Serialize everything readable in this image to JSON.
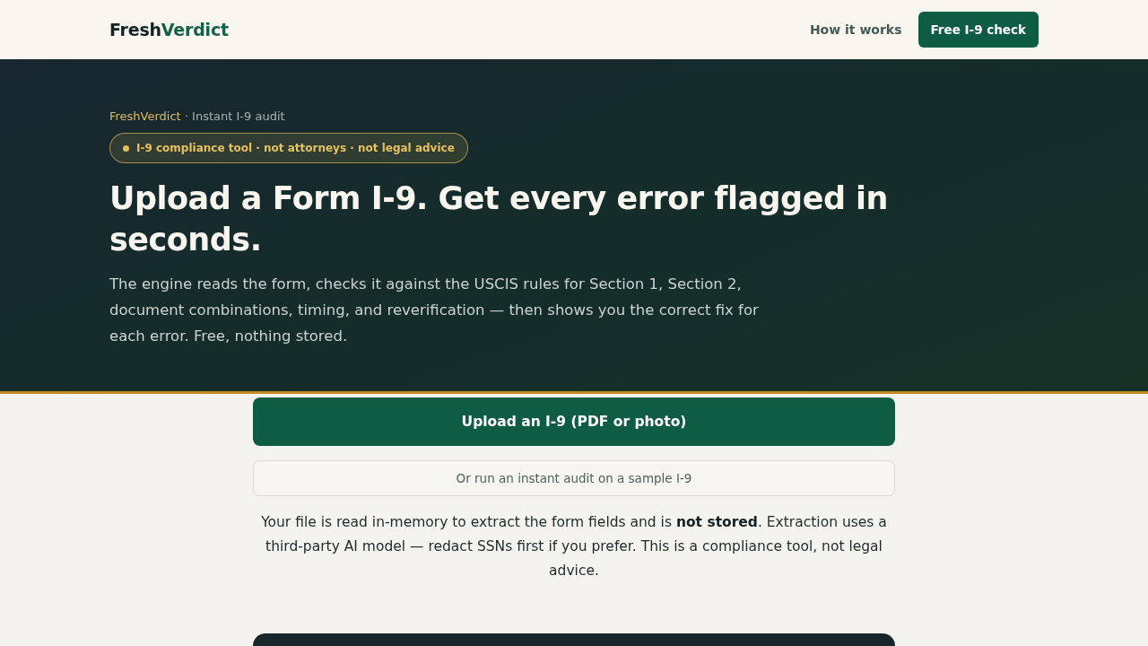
{
  "header": {
    "logo": {
      "first": "Fresh",
      "second": "Verdict"
    },
    "nav_link": "How it works",
    "cta_button": "Free I-9 check"
  },
  "hero": {
    "eyebrow": {
      "brand": "FreshVerdict",
      "text": "· Instant I-9 audit"
    },
    "badge": "I-9 compliance tool · not attorneys · not legal advice",
    "title": "Upload a Form I-9. Get every error flagged in seconds.",
    "description": "The engine reads the form, checks it against the USCIS rules for Section 1, Section 2, document combinations, timing, and reverification — then shows you the correct fix for each error. Free, nothing stored."
  },
  "upload": {
    "primary_button": "Upload an I-9 (PDF or photo)",
    "sample_button": "Or run an instant audit on a sample I-9",
    "notice": "Your file is read in-memory to extract the form fields and is **not stored**. Extraction uses a third-party AI model — redact SSNs first if you prefer. This is a compliance tool, not legal advice."
  }
}
